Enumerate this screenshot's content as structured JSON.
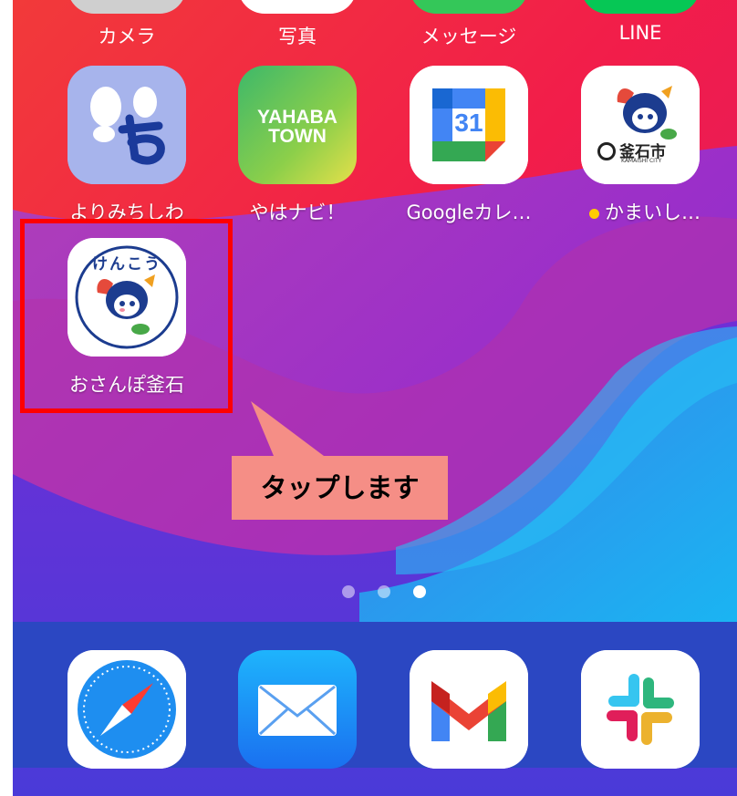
{
  "top_row_labels": [
    "カメラ",
    "写真",
    "メッセージ",
    "LINE"
  ],
  "apps_row2": [
    {
      "label": "よりみちしわ",
      "icon": "footprint-yo-icon"
    },
    {
      "label": "やはナビ！",
      "icon": "yahaba-town-icon",
      "icon_text_line1": "YAHABA",
      "icon_text_line2": "TOWN"
    },
    {
      "label": "Googleカレ…",
      "icon": "google-calendar-icon",
      "icon_text": "31"
    },
    {
      "label": "かまいし…",
      "icon": "kamaishi-city-icon",
      "icon_text": "釜石市",
      "icon_subtext": "KAMAISHI CITY",
      "badge_dot_color": "#ffcc00"
    }
  ],
  "apps_row3": [
    {
      "label": "おさんぽ釜石",
      "icon": "osanpo-kamaishi-icon",
      "icon_text": "けんこう"
    }
  ],
  "page_dots": {
    "count": 3,
    "active_index": 2
  },
  "dock": [
    {
      "icon": "safari-icon"
    },
    {
      "icon": "mail-icon"
    },
    {
      "icon": "gmail-icon"
    },
    {
      "icon": "slack-icon"
    }
  ],
  "callout": {
    "text": "タップします",
    "color": "#f58e86"
  },
  "highlight_color": "#ff0000"
}
